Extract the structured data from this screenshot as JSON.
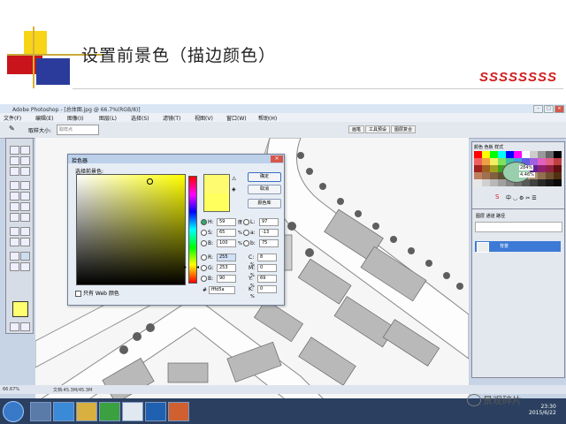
{
  "slide": {
    "title": "设置前景色（描边颜色）",
    "brand": "SSSSSSSS"
  },
  "photoshop": {
    "window_title": "Adobe Photoshop - [总体图.jpg @ 66.7%(RGB/8)]",
    "menu": [
      "文件(F)",
      "编辑(E)",
      "图像(I)",
      "图层(L)",
      "选择(S)",
      "滤镜(T)",
      "视图(V)",
      "窗口(W)",
      "帮助(H)"
    ],
    "options_label": "取样大小:",
    "options_select": "取样点",
    "workspace_tabs": [
      "画笔",
      "工具预设",
      "图层复合"
    ],
    "status_zoom": "66.67%",
    "status_doc": "文档:45.3M/45.3M"
  },
  "color_picker": {
    "title": "拾色器",
    "close": "×",
    "subtitle": "选择前景色:",
    "buttons": [
      "确定",
      "取消",
      "颜色库"
    ],
    "fields": [
      {
        "key": "H:",
        "value": "59",
        "unit": "度",
        "selected": true
      },
      {
        "key": "S:",
        "value": "65",
        "unit": "%",
        "selected": false
      },
      {
        "key": "B:",
        "value": "100",
        "unit": "%",
        "selected": false
      },
      {
        "key": "R:",
        "value": "255",
        "unit": "",
        "selected": false
      },
      {
        "key": "G:",
        "value": "253",
        "unit": "",
        "selected": false
      },
      {
        "key": "B:",
        "value": "90",
        "unit": "",
        "selected": false
      }
    ],
    "lab": [
      {
        "key": "L:",
        "value": "97"
      },
      {
        "key": "a:",
        "value": "-13"
      },
      {
        "key": "b:",
        "value": "75"
      }
    ],
    "cmyk": [
      {
        "key": "C:",
        "value": "8",
        "unit": "%"
      },
      {
        "key": "M:",
        "value": "0",
        "unit": "%"
      },
      {
        "key": "Y:",
        "value": "69",
        "unit": "%"
      },
      {
        "key": "K:",
        "value": "0",
        "unit": "%"
      }
    ],
    "hex_label": "#",
    "hex": "fffd5a",
    "web_only": "只有 Web 颜色",
    "warn_icon": "warning-icon",
    "cube_icon": "web-cube-icon",
    "fg_color": "#fffd5a"
  },
  "swatches_panel": {
    "tabs": "颜色 色板 样式",
    "hue_value": "284%",
    "sat_value": "4.46%"
  },
  "layers_panel": {
    "tabs": "图层 通道 路径",
    "layer_name": "背景"
  },
  "taskbar": {
    "time": "23:30",
    "date": "2015/6/22"
  },
  "watermark": "景观碎片"
}
